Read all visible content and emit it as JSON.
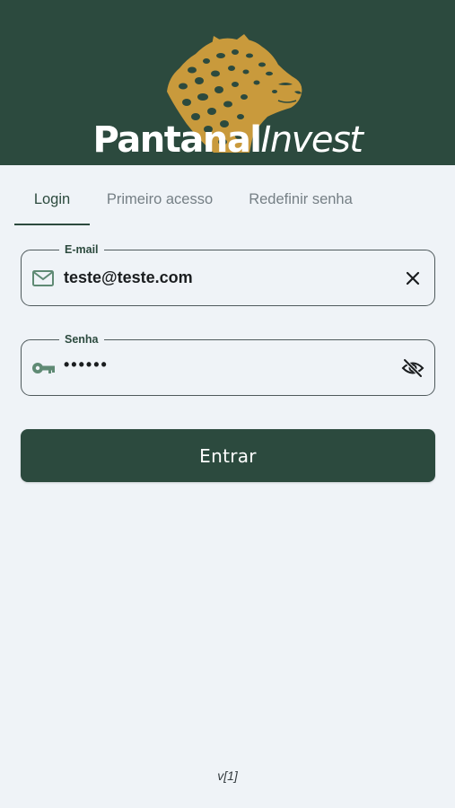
{
  "brand": {
    "name_bold": "Pantanal",
    "name_light": "Invest"
  },
  "tabs": [
    {
      "label": "Login",
      "active": true
    },
    {
      "label": "Primeiro acesso",
      "active": false
    },
    {
      "label": "Redefinir senha",
      "active": false
    }
  ],
  "email": {
    "label": "E-mail",
    "value": "teste@teste.com",
    "icon": "mail-icon",
    "trailing_icon": "clear-icon"
  },
  "senha": {
    "label": "Senha",
    "value": "••••••",
    "icon": "key-icon",
    "trailing_icon": "visibility-off-icon"
  },
  "submit_label": "Entrar",
  "version": "v[1]",
  "colors": {
    "primary": "#2c4a3e",
    "background": "#eff3f7",
    "logo_gold": "#c99a3c"
  }
}
